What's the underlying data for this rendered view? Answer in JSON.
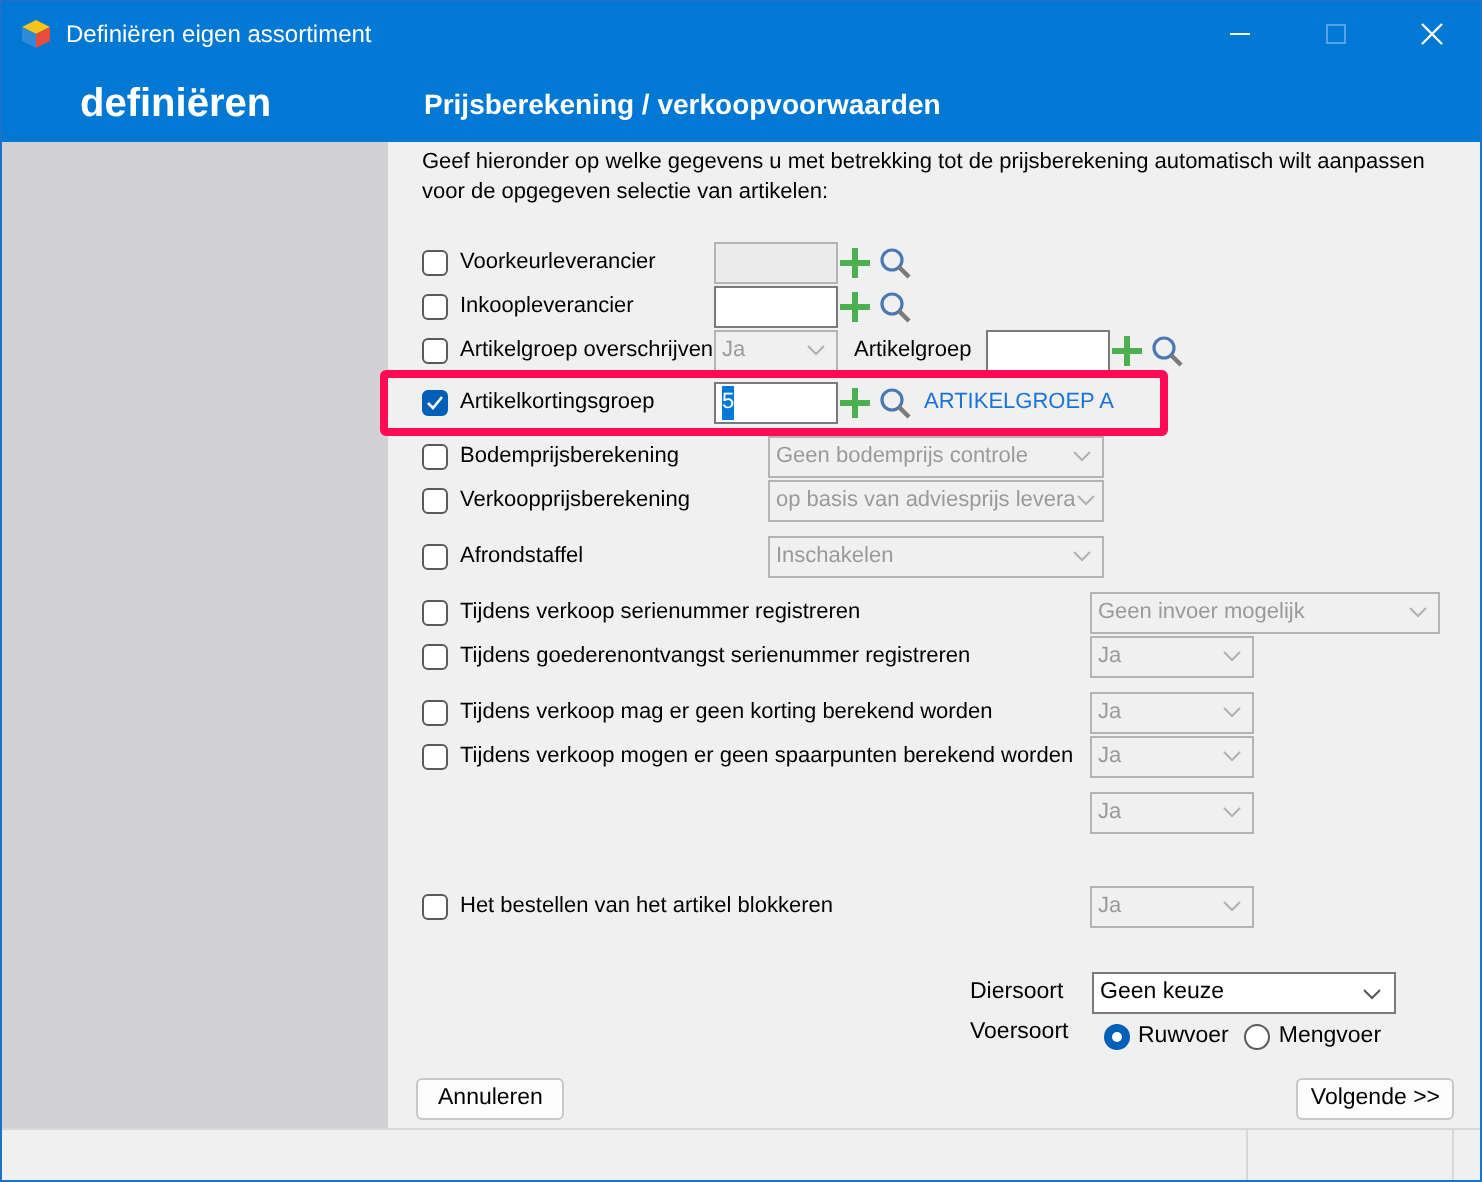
{
  "window": {
    "title": "Definiëren eigen assortiment"
  },
  "header": {
    "section": "definiëren",
    "title": "Prijsberekening / verkoopvoorwaarden"
  },
  "intro": "Geef hieronder op welke gegevens u met betrekking tot de prijsberekening automatisch wilt aanpassen voor de opgegeven selectie van artikelen:",
  "groups": [
    [
      {
        "kind": "short",
        "label": "Voorkeurleverancier",
        "checked": false,
        "controls": [
          {
            "kind": "field",
            "disabled": true
          },
          {
            "kind": "add"
          },
          {
            "kind": "search"
          }
        ]
      },
      {
        "kind": "short",
        "label": "Inkoopleverancier",
        "checked": false,
        "controls": [
          {
            "kind": "field",
            "disabled": false
          },
          {
            "kind": "add"
          },
          {
            "kind": "search"
          }
        ]
      },
      {
        "kind": "short",
        "label": "Artikelgroep overschrijven",
        "checked": false,
        "controls": [
          {
            "kind": "combo",
            "value": "Ja",
            "disabled": true
          },
          {
            "kind": "label",
            "text": "Artikelgroep"
          },
          {
            "kind": "field",
            "disabled": false
          },
          {
            "kind": "add"
          },
          {
            "kind": "search"
          }
        ]
      },
      {
        "kind": "short",
        "label": "Artikelkortingsgroep",
        "checked": true,
        "highlighted": true,
        "controls": [
          {
            "kind": "field",
            "disabled": false,
            "value": "5",
            "value_selected": true
          },
          {
            "kind": "add"
          },
          {
            "kind": "search"
          },
          {
            "kind": "link",
            "text": "ARTIKELGROEP A"
          }
        ]
      },
      {
        "kind": "medium",
        "label": "Bodemprijsberekening",
        "checked": false,
        "controls": [
          {
            "kind": "combo",
            "value": "Geen bodemprijs controle",
            "disabled": true
          }
        ]
      },
      {
        "kind": "medium",
        "label": "Verkoopprijsberekening",
        "checked": false,
        "controls": [
          {
            "kind": "combo",
            "value": "op basis van adviesprijs levera",
            "disabled": true
          }
        ]
      }
    ],
    [
      {
        "kind": "medium",
        "label": "Afrondstaffel",
        "checked": false,
        "controls": [
          {
            "kind": "combo",
            "value": "Inschakelen",
            "disabled": true
          }
        ]
      }
    ],
    [
      {
        "kind": "long",
        "label": "Tijdens verkoop serienummer registreren",
        "checked": false,
        "controls": [
          {
            "kind": "wide",
            "value": "Geen invoer mogelijk",
            "disabled": true
          }
        ]
      },
      {
        "kind": "long",
        "label": "Tijdens goederenontvangst serienummer registreren",
        "checked": false,
        "controls": [
          {
            "kind": "combo",
            "value": "Ja",
            "disabled": true
          }
        ]
      }
    ],
    [
      {
        "kind": "long",
        "label": "Tijdens verkoop mag er geen korting berekend worden",
        "checked": false,
        "controls": [
          {
            "kind": "combo",
            "value": "Ja",
            "disabled": true
          }
        ]
      },
      {
        "kind": "long",
        "label": "Tijdens verkoop mogen er geen spaarpunten berekend worden",
        "checked": false,
        "controls": [
          {
            "kind": "combo",
            "value": "Ja",
            "disabled": true
          }
        ]
      }
    ],
    [
      {
        "kind": "long",
        "controls": [
          {
            "kind": "combo",
            "value": "Ja",
            "disabled": true
          }
        ]
      }
    ],
    [
      {
        "kind": "long",
        "label": "Het bestellen van het artikel blokkeren",
        "checked": false,
        "controls": [
          {
            "kind": "combo",
            "value": "Ja",
            "disabled": true
          }
        ]
      }
    ]
  ],
  "diersoort": {
    "label": "Diersoort",
    "value": "Geen keuze"
  },
  "voersoort": {
    "label": "Voersoort",
    "options": [
      {
        "label": "Ruwvoer",
        "selected": true
      },
      {
        "label": "Mengvoer",
        "selected": false
      }
    ]
  },
  "buttons": {
    "cancel": "Annuleren",
    "next": "Volgende >>"
  }
}
